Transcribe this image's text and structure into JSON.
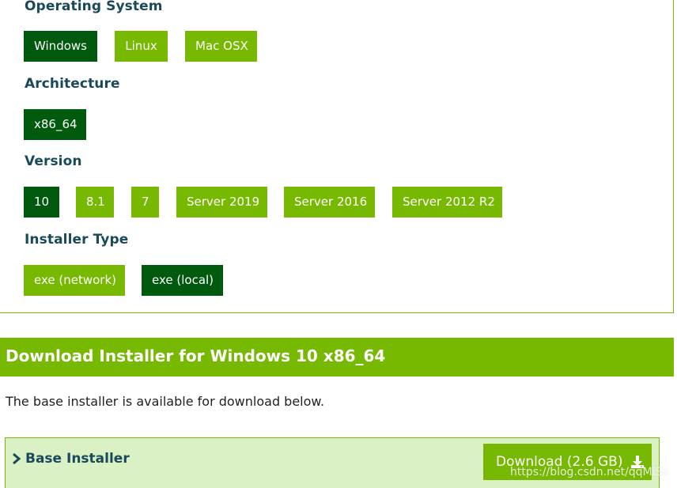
{
  "os": {
    "heading": "Operating System",
    "options": [
      "Windows",
      "Linux",
      "Mac OSX"
    ],
    "selected": "Windows"
  },
  "architecture": {
    "heading": "Architecture",
    "options": [
      "x86_64"
    ],
    "selected": "x86_64"
  },
  "version": {
    "heading": "Version",
    "options": [
      "10",
      "8.1",
      "7",
      "Server 2019",
      "Server 2016",
      "Server 2012 R2"
    ],
    "selected": "10"
  },
  "installer_type": {
    "heading": "Installer Type",
    "options": [
      "exe (network)",
      "exe (local)"
    ],
    "selected": "exe (local)"
  },
  "download": {
    "header": "Download Installer for Windows 10 x86_64",
    "note": "The base installer is available for download below.",
    "base_installer_label": "Base Installer",
    "button_label": "Download (2.6 GB)"
  },
  "watermark": "https://blog.csdn.net/qqMiSa",
  "colors": {
    "green": "#76b900",
    "dark_green": "#005a0e",
    "heading_text": "#1a4a5a",
    "installer_bg": "#daf0c5"
  }
}
